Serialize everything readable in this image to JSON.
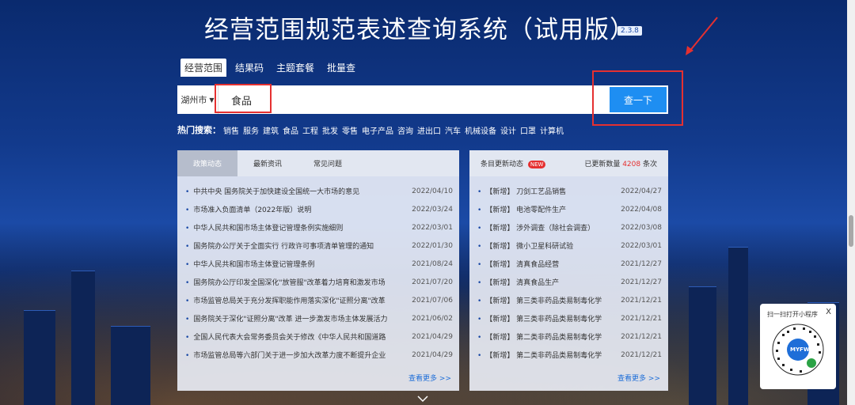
{
  "title": "经营范围规范表述查询系统（试用版）",
  "version": "2.3.8",
  "tabs": [
    "经营范围",
    "结果码",
    "主题套餐",
    "批量查"
  ],
  "search": {
    "city": "湖州市",
    "value": "食品",
    "button": "查一下"
  },
  "hot": {
    "label": "热门搜索：",
    "items": [
      "销售",
      "服务",
      "建筑",
      "食品",
      "工程",
      "批发",
      "零售",
      "电子产品",
      "咨询",
      "进出口",
      "汽车",
      "机械设备",
      "设计",
      "口罩",
      "计算机"
    ]
  },
  "left_panel": {
    "tabs": [
      "政策动态",
      "最新资讯",
      "常见问题"
    ],
    "items": [
      {
        "title": "中共中央 国务院关于加快建设全国统一大市场的意见",
        "date": "2022/04/10"
      },
      {
        "title": "市场准入负面清单（2022年版）说明",
        "date": "2022/03/24"
      },
      {
        "title": "中华人民共和国市场主体登记管理条例实施细则",
        "date": "2022/03/01"
      },
      {
        "title": "国务院办公厅关于全面实行 行政许可事项清单管理的通知",
        "date": "2022/01/30"
      },
      {
        "title": "中华人民共和国市场主体登记管理条例",
        "date": "2021/08/24"
      },
      {
        "title": "国务院办公厅印发全国深化\"放管服\"改革着力培育和激发市场",
        "date": "2021/07/20"
      },
      {
        "title": "市场监管总局关于充分发挥职能作用落实深化\"证照分离\"改革",
        "date": "2021/07/06"
      },
      {
        "title": "国务院关于深化\"证照分离\"改革 进一步激发市场主体发展活力",
        "date": "2021/06/02"
      },
      {
        "title": "全国人民代表大会常务委员会关于修改《中华人民共和国道路",
        "date": "2021/04/29"
      },
      {
        "title": "市场监管总局等六部门关于进一步加大改革力度不断提升企业",
        "date": "2021/04/29"
      }
    ],
    "more": "查看更多 >>"
  },
  "right_panel": {
    "header": "条目更新动态",
    "badge": "NEW",
    "count_label": "已更新数量",
    "count": "4208",
    "count_unit": "条次",
    "items": [
      {
        "title": "【新增】 刀剑工艺品销售",
        "date": "2022/04/27"
      },
      {
        "title": "【新增】 电池零配件生产",
        "date": "2022/04/08"
      },
      {
        "title": "【新增】 涉外调查（除社会调查）",
        "date": "2022/03/08"
      },
      {
        "title": "【新增】 微小卫星科研试验",
        "date": "2022/03/01"
      },
      {
        "title": "【新增】 清真食品经营",
        "date": "2021/12/27"
      },
      {
        "title": "【新增】 清真食品生产",
        "date": "2021/12/27"
      },
      {
        "title": "【新增】 第三类非药品类易制毒化学",
        "date": "2021/12/21"
      },
      {
        "title": "【新增】 第三类非药品类易制毒化学",
        "date": "2021/12/21"
      },
      {
        "title": "【新增】 第二类非药品类易制毒化学",
        "date": "2021/12/21"
      },
      {
        "title": "【新增】 第二类非药品类易制毒化学",
        "date": "2021/12/21"
      }
    ],
    "more": "查看更多 >>"
  },
  "qr": {
    "text": "扫一扫打开小程序",
    "close": "X",
    "logo_text": "MYFW"
  },
  "colors": {
    "accent": "#1e8ef2",
    "highlight": "#e53030",
    "bg": "#123a8c"
  }
}
